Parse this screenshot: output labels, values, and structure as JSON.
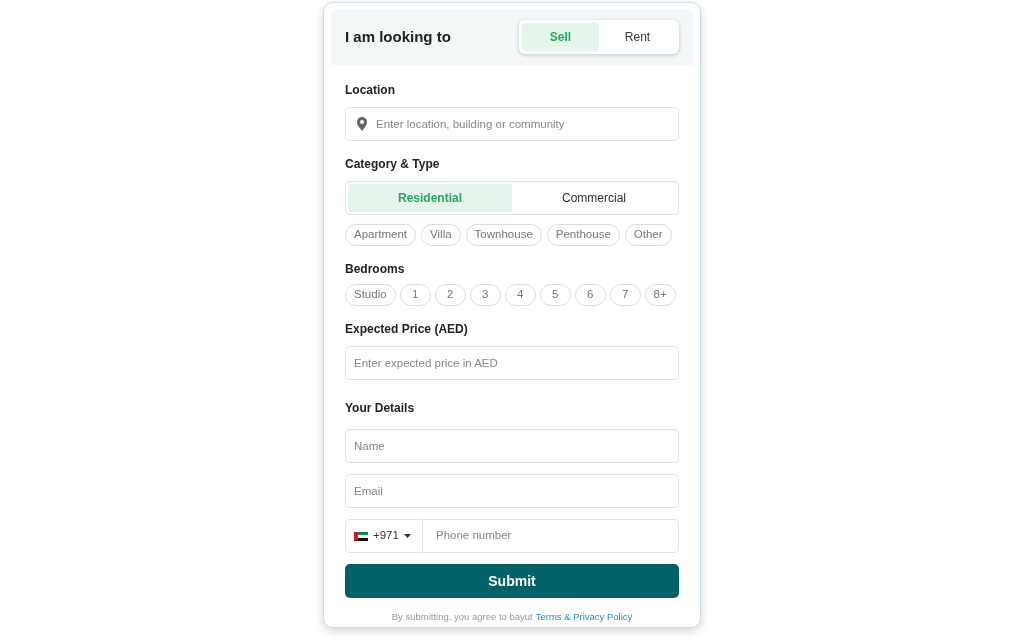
{
  "header": {
    "title": "I am looking to",
    "purpose": [
      {
        "label": "Sell",
        "selected": true
      },
      {
        "label": "Rent",
        "selected": false
      }
    ]
  },
  "location": {
    "label": "Location",
    "placeholder": "Enter location, building or community"
  },
  "category": {
    "label": "Category & Type",
    "options": [
      {
        "label": "Residential",
        "selected": true
      },
      {
        "label": "Commercial",
        "selected": false
      }
    ],
    "types": [
      {
        "label": "Apartment",
        "selected": false
      },
      {
        "label": "Villa",
        "selected": false
      },
      {
        "label": "Townhouse",
        "selected": false
      },
      {
        "label": "Penthouse",
        "selected": false
      },
      {
        "label": "Other",
        "selected": false
      }
    ]
  },
  "bedrooms": {
    "label": "Bedrooms",
    "options": [
      {
        "label": "Studio",
        "selected": false
      },
      {
        "label": "1",
        "selected": false
      },
      {
        "label": "2",
        "selected": false
      },
      {
        "label": "3",
        "selected": false
      },
      {
        "label": "4",
        "selected": false
      },
      {
        "label": "5",
        "selected": false
      },
      {
        "label": "6",
        "selected": false
      },
      {
        "label": "7",
        "selected": false
      },
      {
        "label": "8+",
        "selected": false
      }
    ]
  },
  "price": {
    "label": "Expected Price (AED)",
    "placeholder": "Enter expected price in AED"
  },
  "details": {
    "label": "Your Details",
    "name_placeholder": "Name",
    "email_placeholder": "Email",
    "country_code": "+971",
    "phone_placeholder": "Phone number"
  },
  "submit": "Submit",
  "terms": {
    "text": "By submitting, you agree to bayut",
    "link": "Terms & Privacy Policy"
  }
}
